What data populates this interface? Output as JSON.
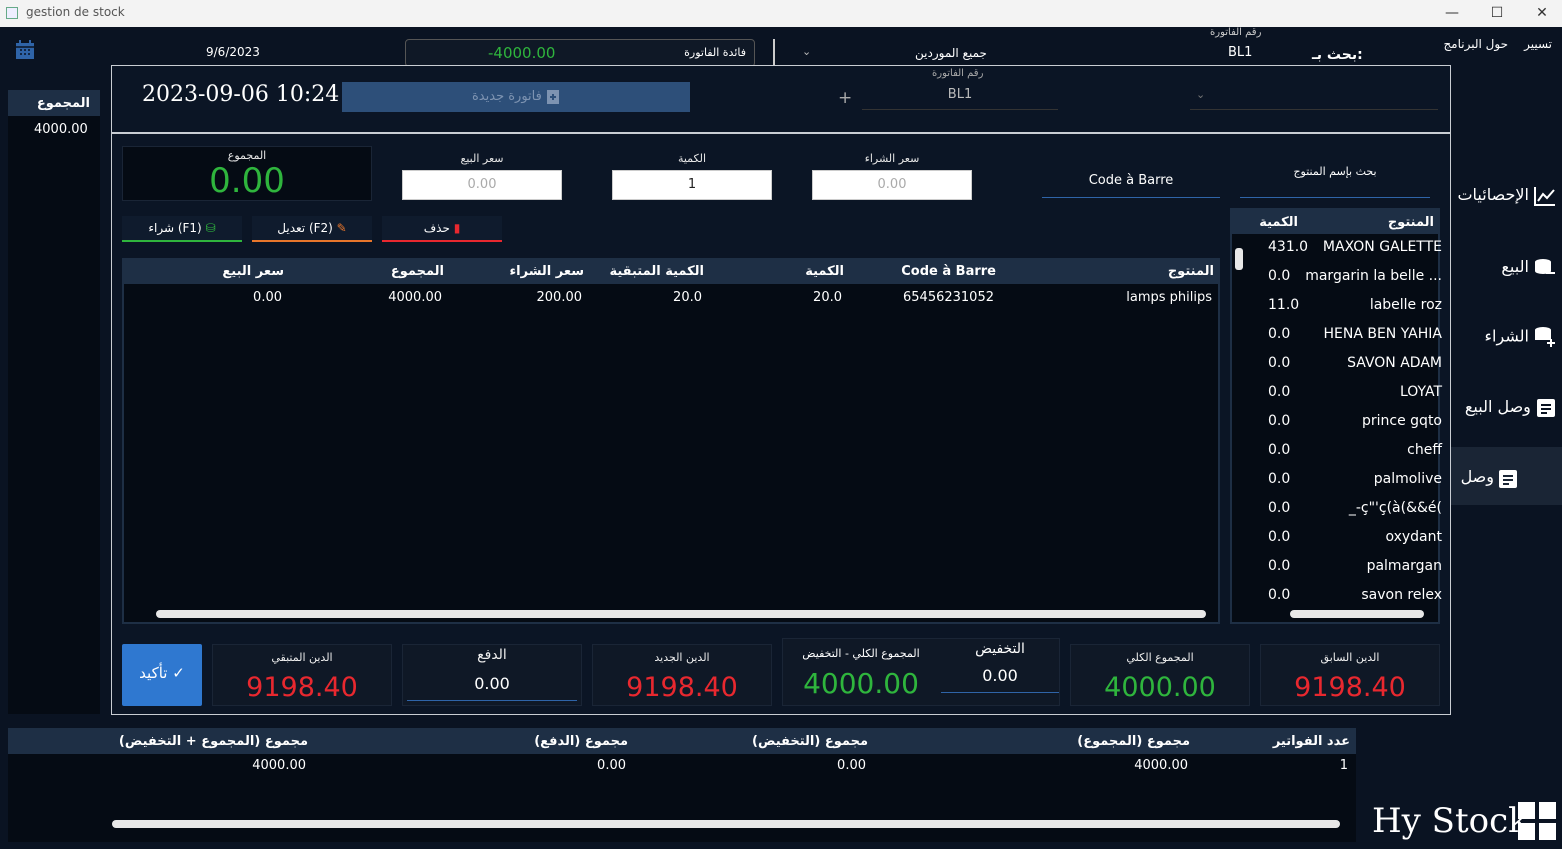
{
  "window": {
    "title": "gestion de stock"
  },
  "menu": {
    "manage": "تسيير",
    "about": "حول البرنامج"
  },
  "topbar": {
    "date": "9/6/2023",
    "profit_label": "فائدة الفاتورة",
    "profit_value": "-4000.00",
    "supplier_filter": "جميع الموردين",
    "invoice_no_label": "رقم الفاتورة",
    "invoice_no_value": "BL1",
    "search_by": "بحث بـ:"
  },
  "left_panel": {
    "header": "المجموع",
    "value": "4000.00"
  },
  "sidebar": {
    "items": [
      {
        "label": "الإحصائيات",
        "icon": "chart-icon"
      },
      {
        "label": "البيع",
        "icon": "coins-icon"
      },
      {
        "label": "الشراء",
        "icon": "database-plus-icon"
      },
      {
        "label": "وصل البيع",
        "icon": "receipt-icon"
      },
      {
        "label": "وصل",
        "icon": "receipt-icon"
      }
    ],
    "logo_text": "Hy Stock"
  },
  "dialog": {
    "datetime": "2023-09-06 10:24",
    "new_invoice_button": "فاتورة جديدة",
    "invoice_no_label": "رقم الفاتورة",
    "invoice_no_value": "BL1",
    "total_label": "المجموع",
    "total_value": "0.00",
    "sell_price_label": "سعر البيع",
    "sell_price_placeholder": "0.00",
    "quantity_label": "الكمية",
    "quantity_value": "1",
    "buy_price_label": "سعر الشراء",
    "buy_price_placeholder": "0.00",
    "barcode_tab": "Code à Barre",
    "search_name_tab": "بحث بإسم المنتوج",
    "buy_button": "شراء (F1)",
    "edit_button": "تعديل (F2)",
    "delete_button": "حذف",
    "table": {
      "headers": {
        "product": "المنتوج",
        "barcode": "Code à Barre",
        "quantity": "الكمية",
        "remaining": "الكمية المتبقية",
        "buy_price": "سعر الشراء",
        "total": "المجموع",
        "sell_price": "سعر البيع"
      },
      "rows": [
        {
          "product": "lamps philips",
          "barcode": "65456231052",
          "quantity": "20.0",
          "remaining": "20.0",
          "buy_price": "200.00",
          "total": "4000.00",
          "sell_price": "0.00"
        }
      ]
    },
    "product_list": {
      "header_product": "المنتوج",
      "header_qty": "الكمية",
      "rows": [
        {
          "name": "MAXON GALETTE",
          "qty": "431.0"
        },
        {
          "name": "margarin la belle ...",
          "qty": "0.0"
        },
        {
          "name": "labelle roz",
          "qty": "11.0"
        },
        {
          "name": "HENA BEN YAHIA",
          "qty": "0.0"
        },
        {
          "name": "SAVON ADAM",
          "qty": "0.0"
        },
        {
          "name": "LOYAT",
          "qty": "0.0"
        },
        {
          "name": "prince gqto",
          "qty": "0.0"
        },
        {
          "name": "cheff",
          "qty": "0.0"
        },
        {
          "name": "palmolive",
          "qty": "0.0"
        },
        {
          "name": "_-ç\"'ç(à(&&é(",
          "qty": "0.0"
        },
        {
          "name": "oxydant",
          "qty": "0.0"
        },
        {
          "name": "palmargan",
          "qty": "0.0"
        },
        {
          "name": "savon relex",
          "qty": "0.0"
        }
      ]
    },
    "summary": {
      "confirm_button": "تأكيد",
      "remaining_debt_label": "الدين المتبقي",
      "remaining_debt_value": "9198.40",
      "payment_label": "الدفع",
      "payment_value": "0.00",
      "new_debt_label": "الدين الجديد",
      "new_debt_value": "9198.40",
      "total_minus_discount_label": "المجموع الكلي - التخفيض",
      "total_minus_discount_value": "4000.00",
      "discount_label": "التخفيض",
      "discount_value": "0.00",
      "grand_total_label": "المجموع الكلي",
      "grand_total_value": "4000.00",
      "previous_debt_label": "الدين السابق",
      "previous_debt_value": "9198.40"
    }
  },
  "bottom_table": {
    "headers": {
      "count": "عدد الفواتير",
      "sum_total": "مجموع (المجموع)",
      "sum_discount": "مجموع (التخفيض)",
      "sum_payment": "مجموع (الدفع)",
      "sum_total_discount": "مجموع (المجموع + التخفيض)"
    },
    "row": {
      "count": "1",
      "sum_total": "4000.00",
      "sum_discount": "0.00",
      "sum_payment": "0.00",
      "sum_total_discount": "4000.00"
    }
  },
  "colors": {
    "accent": "#2f64a8",
    "red": "#e8282f",
    "green": "#2fb53d",
    "background": "#0a1322"
  }
}
